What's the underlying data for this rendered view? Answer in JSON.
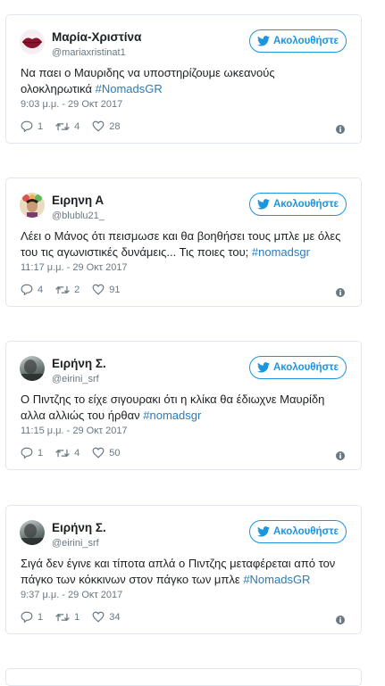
{
  "follow_label": "Ακολουθήστε",
  "tweets": [
    {
      "name": "Μαρία-Χριστίνα",
      "handle": "@mariaxristinat1",
      "text": "Να παει ο Μαυριδης να υποστηρίζουμε ωκεανούς ολοκληρωτικά ",
      "hashtag": "#NomadsGR",
      "time": "9:03 μ.μ. - 29 Οκτ 2017",
      "replies": "1",
      "retweets": "4",
      "likes": "28"
    },
    {
      "name": "Ειρηνη Α",
      "handle": "@blublu21_",
      "text": "Λέει ο Μάνος ότι πεισμωσε και θα βοηθήσει τους μπλε με όλες του τις αγωνιστικές δυνάμεις... Τις ποιες του; ",
      "hashtag": "#nomadsgr",
      "time": "11:17 μ.μ. - 29 Οκτ 2017",
      "replies": "4",
      "retweets": "2",
      "likes": "91"
    },
    {
      "name": "Ειρήνη Σ.",
      "handle": "@eirini_srf",
      "text": "Ο Πιντζης το είχε σιγουρακι ότι η κλίκα θα έδιωχνε Μαυρίδη αλλα αλλιώς του ήρθαν ",
      "hashtag": "#nomadsgr",
      "time": "11:15 μ.μ. - 29 Οκτ 2017",
      "replies": "1",
      "retweets": "4",
      "likes": "50"
    },
    {
      "name": "Ειρήνη Σ.",
      "handle": "@eirini_srf",
      "text": "Σιγά δεν έγινε και τίποτα απλά ο Πιντζης μεταφέρεται από τον πάγκο των κόκκινων στον πάγκο των μπλε ",
      "hashtag": "#NomadsGR",
      "time": "9:37 μ.μ. - 29 Οκτ 2017",
      "replies": "1",
      "retweets": "1",
      "likes": "34"
    }
  ],
  "icons": {
    "follow": "twitter-bird-icon",
    "reply": "reply-icon",
    "retweet": "retweet-icon",
    "like": "heart-icon",
    "info": "info-icon"
  },
  "colors": {
    "accent": "#1b95e0",
    "hashtag": "#2b7bb9",
    "muted": "#697882",
    "border": "#e1e8ed"
  }
}
